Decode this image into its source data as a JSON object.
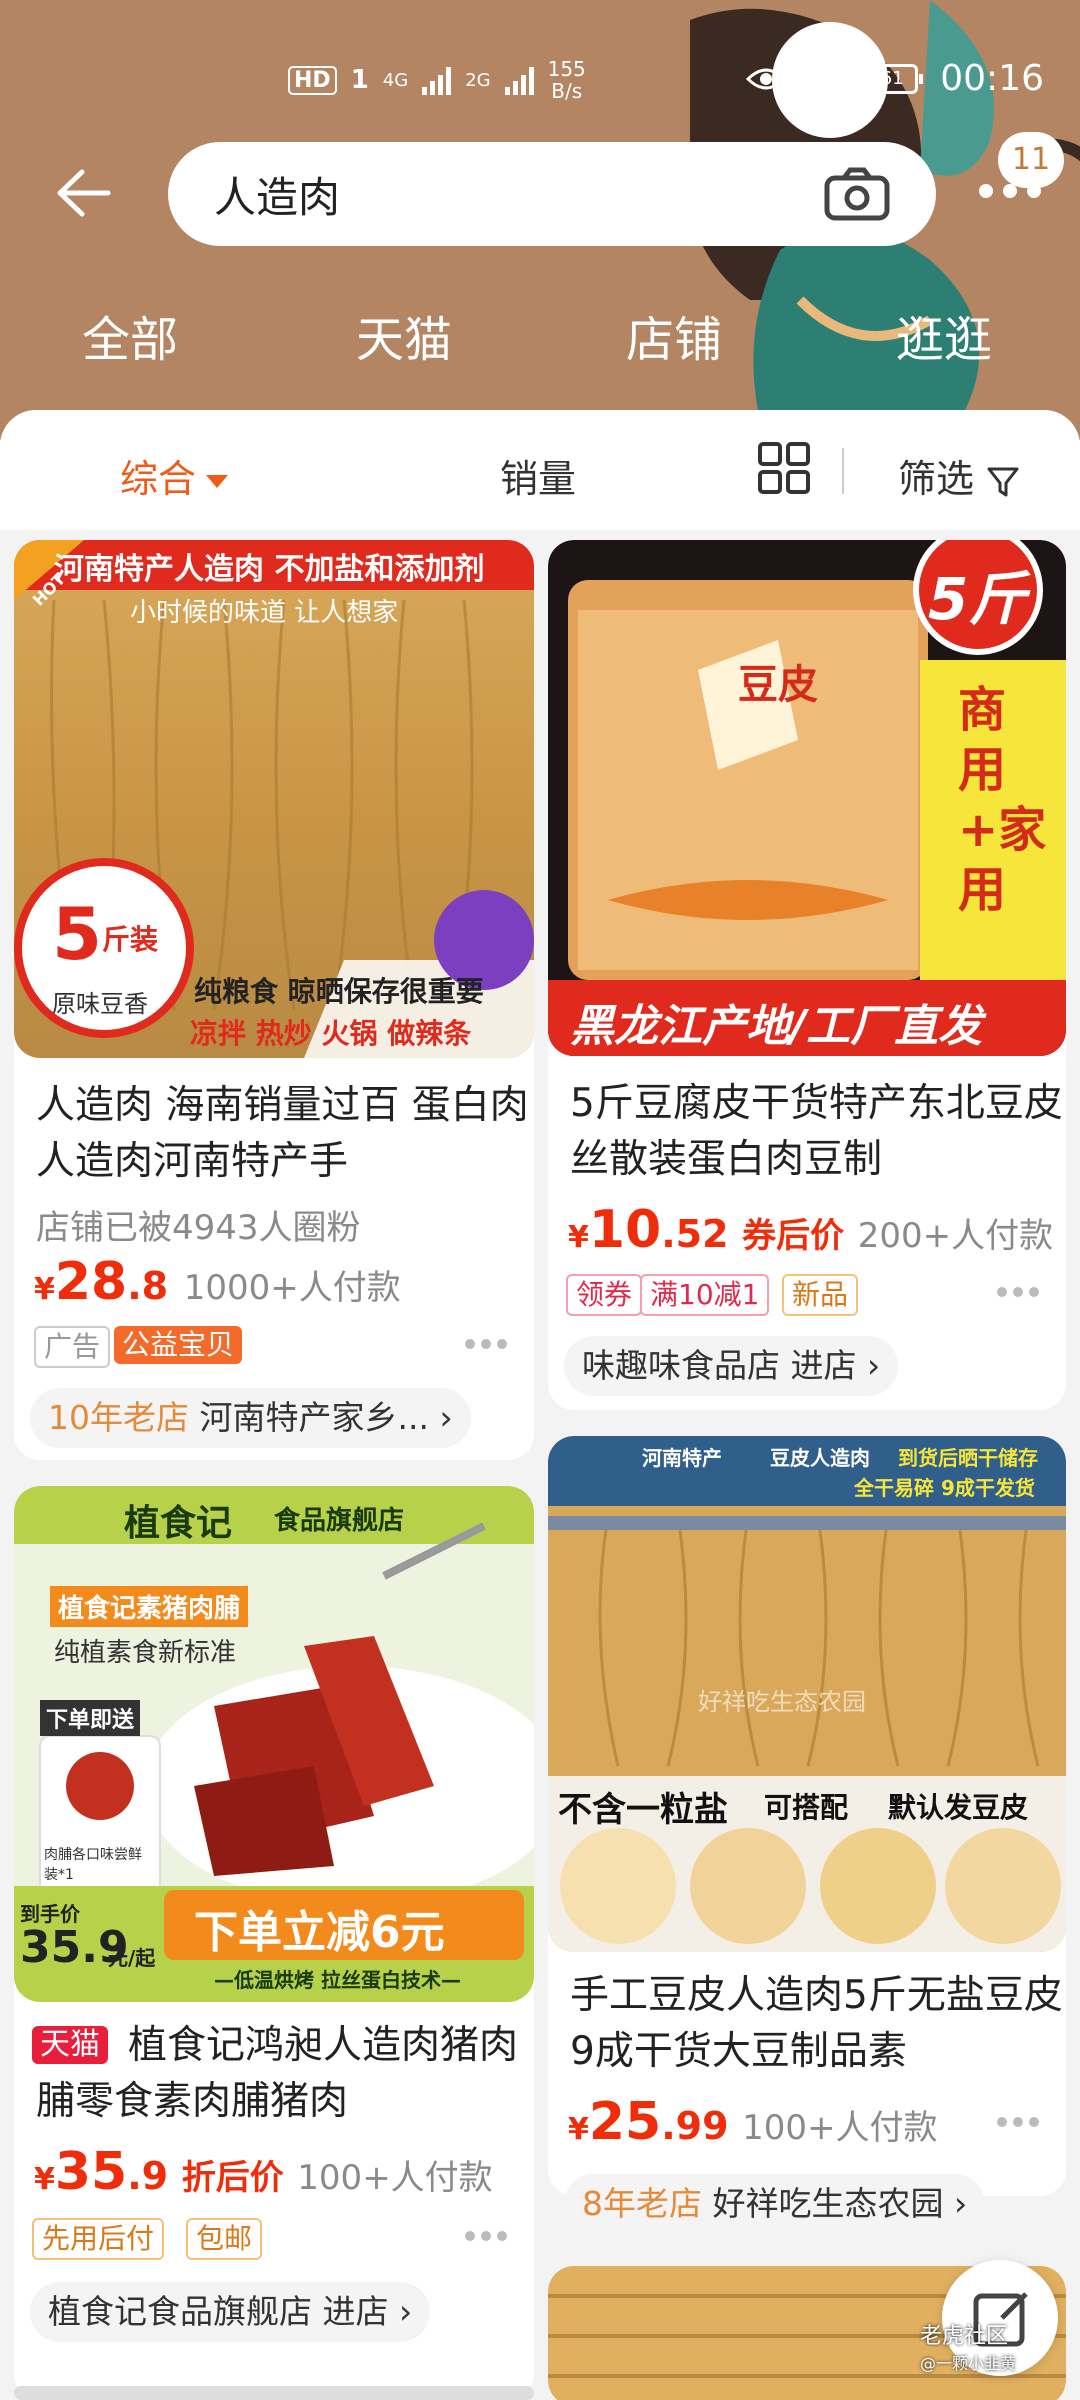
{
  "status": {
    "hd": "HD",
    "sim": "1",
    "net1": "4G",
    "net2": "2G",
    "speed_value": "155",
    "speed_unit": "B/s",
    "battery": "61",
    "time": "00:16"
  },
  "search": {
    "query": "人造肉",
    "more_badge": "11"
  },
  "tabs": [
    "全部",
    "天猫",
    "店铺",
    "逛逛"
  ],
  "sortbar": {
    "comprehensive": "综合",
    "sales": "销量",
    "filter": "筛选"
  },
  "products": [
    {
      "img_banner": "河南特产人造肉 不加盐和添加剂",
      "img_sub": "小时候的味道 让人想家",
      "img_hot": "HOT",
      "img_badge_num": "5",
      "img_badge_unit": "斤装",
      "img_badge_sub": "原味豆香",
      "img_line1": "纯粮食 晾晒保存很重要",
      "img_line2": "凉拌 热炒 火锅 做辣条",
      "title": "人造肉 海南销量过百 蛋白肉人造肉河南特产手",
      "fans": "店铺已被4943人圈粉",
      "price_yen": "¥",
      "price_int": "28",
      "price_dec": ".8",
      "paid": "1000+人付款",
      "tag_ad": "广告",
      "tag_charity": "公益宝贝",
      "store_years": "10年老店",
      "store_name": "河南特产家乡...",
      "colors": {
        "accent": "#f02d0b"
      }
    },
    {
      "img_corner": "5斤",
      "img_side": "商用+家用",
      "img_bottom": "黑龙江产地/工厂直发",
      "img_bag": "豆皮",
      "title": "5斤豆腐皮干货特产东北豆皮丝散装蛋白肉豆制",
      "price_yen": "¥",
      "price_int": "10",
      "price_dec": ".52",
      "price_note": "券后价",
      "paid": "200+人付款",
      "tag_coupon": "领券",
      "tag_discount": "满10减1",
      "tag_new": "新品",
      "store": "味趣味食品店 进店"
    },
    {
      "img_brand": "植食记",
      "img_brand_sub": "食品旗舰店",
      "img_label1": "植食记素猪肉脯",
      "img_label2": "纯植素食新标准",
      "img_gift": "下单即送",
      "img_gift_sub": "肉脯各口味尝鲜装*1",
      "img_arrive": "到手价",
      "img_arrive_price": "35.9",
      "img_arrive_unit": "元/起",
      "img_promo": "下单立减6元",
      "img_promo_sub": "—低温烘烤 拉丝蛋白技术—",
      "tmall": "天猫",
      "title": "植食记鸿昶人造肉猪肉脯零食素肉脯猪肉",
      "price_yen": "¥",
      "price_int": "35",
      "price_dec": ".9",
      "price_note": "折后价",
      "paid": "100+人付款",
      "tag_pay_later": "先用后付",
      "tag_free_ship": "包邮",
      "store": "植食记食品旗舰店 进店"
    },
    {
      "img_top1": "河南特产",
      "img_top2": "豆皮人造肉",
      "img_top3": "到货后晒干储存",
      "img_top4": "全干易碎 9成干发货",
      "img_watermark": "好祥吃生态农园",
      "img_line1": "不含一粒盐",
      "img_line2": "可搭配",
      "img_line3": "默认发豆皮",
      "title": "手工豆皮人造肉5斤无盐豆皮9成干货大豆制品素",
      "price_yen": "¥",
      "price_int": "25",
      "price_dec": ".99",
      "paid": "100+人付款",
      "store_years": "8年老店",
      "store_name": "好祥吃生态农园"
    }
  ],
  "watermark": "老虎社区",
  "watermark_sub": "@一颗小韭黄"
}
